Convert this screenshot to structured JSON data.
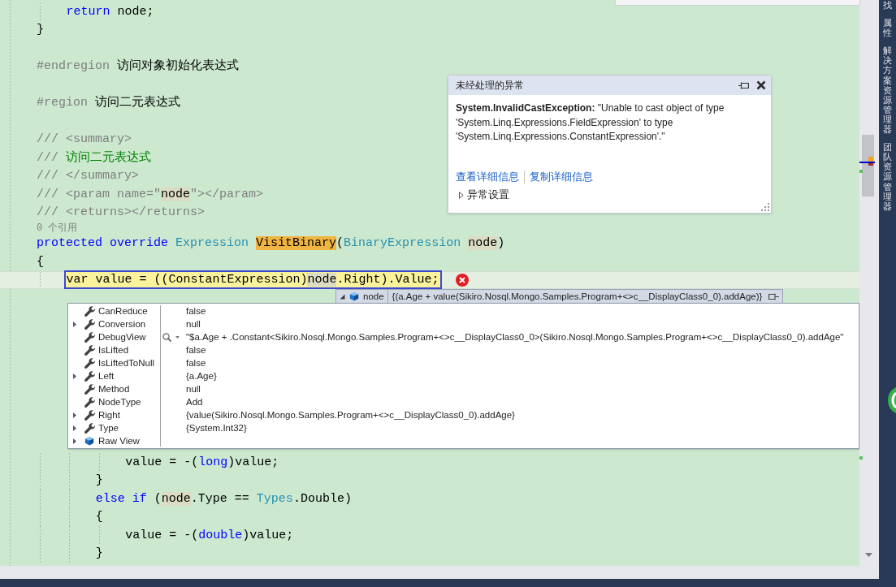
{
  "editor": {
    "code_above": [
      {
        "kind": "block",
        "lines": [
          {
            "kind": "code",
            "tokens": [
              {
                "text": "return",
                "kind": "keyword"
              },
              {
                "text": " node;",
                "kind": "plain"
              }
            ]
          }
        ]
      },
      {
        "kind": "code",
        "tokens": [
          {
            "text": "}",
            "kind": "plain"
          }
        ]
      },
      {
        "kind": "blank"
      },
      {
        "kind": "code",
        "tokens": [
          {
            "text": "#endregion",
            "kind": "preprocessor"
          },
          {
            "text": " 访问对象初始化表达式",
            "kind": "plain"
          }
        ]
      },
      {
        "kind": "blank"
      },
      {
        "kind": "code",
        "tokens": [
          {
            "text": "#region",
            "kind": "preprocessor"
          },
          {
            "text": " 访问二元表达式",
            "kind": "plain"
          }
        ]
      },
      {
        "kind": "blank"
      },
      {
        "kind": "code",
        "tokens": [
          {
            "text": "/// <summary>",
            "kind": "doc"
          }
        ]
      },
      {
        "kind": "code",
        "tokens": [
          {
            "text": "/// ",
            "kind": "doc"
          },
          {
            "text": "访问二元表达式",
            "kind": "comment"
          }
        ]
      },
      {
        "kind": "code",
        "tokens": [
          {
            "text": "/// </summary>",
            "kind": "doc"
          }
        ]
      },
      {
        "kind": "code",
        "tokens": [
          {
            "text": "/// <param name=\"",
            "kind": "doc"
          },
          {
            "text": "node",
            "kind": "reference"
          },
          {
            "text": "\"></param>",
            "kind": "doc"
          }
        ]
      },
      {
        "kind": "code",
        "tokens": [
          {
            "text": "/// <returns></returns>",
            "kind": "doc"
          }
        ]
      },
      {
        "kind": "codelens",
        "text": "0 个引用"
      },
      {
        "kind": "code",
        "tokens": [
          {
            "text": "protected override ",
            "kind": "keyword"
          },
          {
            "text": "Expression ",
            "kind": "type"
          },
          {
            "text": "VisitBinary",
            "kind": "definition"
          },
          {
            "text": "(",
            "kind": "plain"
          },
          {
            "text": "BinaryExpression ",
            "kind": "type"
          },
          {
            "text": "node",
            "kind": "reference"
          },
          {
            "text": ")",
            "kind": "plain"
          }
        ]
      },
      {
        "kind": "code",
        "tokens": [
          {
            "text": "{",
            "kind": "plain"
          }
        ]
      },
      {
        "kind": "block",
        "lines": [
          {
            "kind": "current",
            "tokens": [
              {
                "text": "var value = ((ConstantExpression)",
                "kind": "plain"
              },
              {
                "text": "node",
                "kind": "reference"
              },
              {
                "text": ".Right).Value;",
                "kind": "plain"
              }
            ]
          }
        ]
      }
    ],
    "datatip": {
      "name": "node",
      "value": "{(a.Age + value(Sikiro.Nosql.Mongo.Samples.Program+<>c__DisplayClass0_0).addAge)}",
      "expanded": true,
      "members": [
        {
          "name": "CanReduce",
          "value": "false",
          "kind": "property",
          "expandable": false,
          "visualizer": false
        },
        {
          "name": "Conversion",
          "value": "null",
          "kind": "property",
          "expandable": true,
          "visualizer": false
        },
        {
          "name": "DebugView",
          "value": "\"$a.Age + .Constant<Sikiro.Nosql.Mongo.Samples.Program+<>c__DisplayClass0_0>(Sikiro.Nosql.Mongo.Samples.Program+<>c__DisplayClass0_0).addAge\"",
          "kind": "property",
          "expandable": false,
          "visualizer": true
        },
        {
          "name": "IsLifted",
          "value": "false",
          "kind": "property",
          "expandable": false,
          "visualizer": false
        },
        {
          "name": "IsLiftedToNull",
          "value": "false",
          "kind": "property",
          "expandable": false,
          "visualizer": false
        },
        {
          "name": "Left",
          "value": "{a.Age}",
          "kind": "property",
          "expandable": true,
          "visualizer": false
        },
        {
          "name": "Method",
          "value": "null",
          "kind": "property",
          "expandable": false,
          "visualizer": false
        },
        {
          "name": "NodeType",
          "value": "Add",
          "kind": "property",
          "expandable": false,
          "visualizer": false
        },
        {
          "name": "Right",
          "value": "{value(Sikiro.Nosql.Mongo.Samples.Program+<>c__DisplayClass0_0).addAge}",
          "kind": "property",
          "expandable": true,
          "visualizer": false
        },
        {
          "name": "Type",
          "value": "{System.Int32}",
          "kind": "property",
          "expandable": true,
          "visualizer": false
        },
        {
          "name": "Raw View",
          "kind": "raw",
          "expandable": true,
          "visualizer": false
        }
      ]
    },
    "code_below": [
      {
        "kind": "block",
        "lines": [
          {
            "kind": "block",
            "lines": [
              {
                "kind": "block",
                "lines": [
                  {
                    "kind": "code",
                    "tokens": [
                      {
                        "text": "value = -(",
                        "kind": "plain"
                      },
                      {
                        "text": "long",
                        "kind": "keyword"
                      },
                      {
                        "text": ")value;",
                        "kind": "plain"
                      }
                    ]
                  }
                ]
              },
              {
                "kind": "code",
                "tokens": [
                  {
                    "text": "}",
                    "kind": "plain"
                  }
                ]
              },
              {
                "kind": "code",
                "tokens": [
                  {
                    "text": "else if",
                    "kind": "keyword"
                  },
                  {
                    "text": " (",
                    "kind": "plain"
                  },
                  {
                    "text": "node",
                    "kind": "reference"
                  },
                  {
                    "text": ".Type == ",
                    "kind": "plain"
                  },
                  {
                    "text": "Types",
                    "kind": "type"
                  },
                  {
                    "text": ".Double)",
                    "kind": "plain"
                  }
                ]
              },
              {
                "kind": "code",
                "tokens": [
                  {
                    "text": "{",
                    "kind": "plain"
                  }
                ]
              },
              {
                "kind": "block",
                "lines": [
                  {
                    "kind": "code",
                    "tokens": [
                      {
                        "text": "value = -(",
                        "kind": "plain"
                      },
                      {
                        "text": "double",
                        "kind": "keyword"
                      },
                      {
                        "text": ")value;",
                        "kind": "plain"
                      }
                    ]
                  }
                ]
              },
              {
                "kind": "code",
                "tokens": [
                  {
                    "text": "}",
                    "kind": "plain"
                  }
                ]
              }
            ]
          }
        ]
      }
    ]
  },
  "exception_popup": {
    "title": "未经处理的异常",
    "message": "**System.InvalidCastException:** \"Unable to cast object of type 'System.Linq.Expressions.FieldExpression' to type 'System.Linq.Expressions.ConstantExpression'.\"",
    "links": [
      "查看详细信息",
      "复制详细信息"
    ],
    "settings": {
      "label": "异常设置",
      "expanded": false
    }
  },
  "dock_tabs": [
    "找",
    "属性",
    "解决方案资源管理器",
    "团队资源管理器"
  ]
}
